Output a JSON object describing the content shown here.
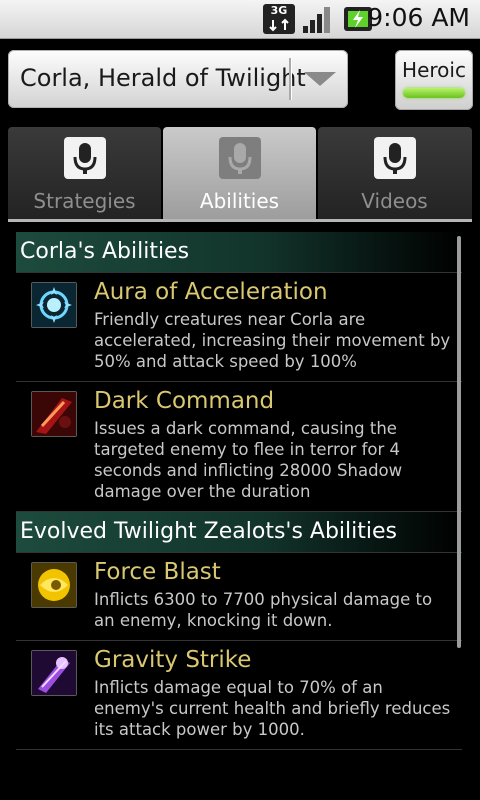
{
  "status_bar": {
    "network": "3G",
    "time": "9:06 AM"
  },
  "header": {
    "boss_select": "Corla, Herald of Twilight",
    "mode_button": "Heroic",
    "mode_active": true
  },
  "tabs": [
    {
      "label": "Strategies",
      "active": false
    },
    {
      "label": "Abilities",
      "active": true
    },
    {
      "label": "Videos",
      "active": false
    }
  ],
  "sections": [
    {
      "title": "Corla's Abilities",
      "abilities": [
        {
          "name": "Aura of Acceleration",
          "icon": "aura-icon",
          "desc": "Friendly creatures near Corla are accelerated, increasing their movement by 50% and attack speed by 100%"
        },
        {
          "name": "Dark Command",
          "icon": "dark-command-icon",
          "desc": "Issues a dark command, causing the targeted enemy to flee in terror for 4 seconds and inflicting 28000 Shadow damage over the duration"
        }
      ]
    },
    {
      "title": "Evolved Twilight Zealots's Abilities",
      "abilities": [
        {
          "name": "Force Blast",
          "icon": "force-blast-icon",
          "desc": "Inflicts 6300 to 7700 physical damage to an enemy, knocking it down."
        },
        {
          "name": "Gravity Strike",
          "icon": "gravity-strike-icon",
          "desc": "Inflicts damage equal to 70% of an enemy's current health and briefly reduces its attack power by 1000."
        }
      ]
    }
  ],
  "colors": {
    "ability_title": "#d9c870",
    "section_bg": "#1d4b3d",
    "mode_indicator": "#8fd84a"
  }
}
